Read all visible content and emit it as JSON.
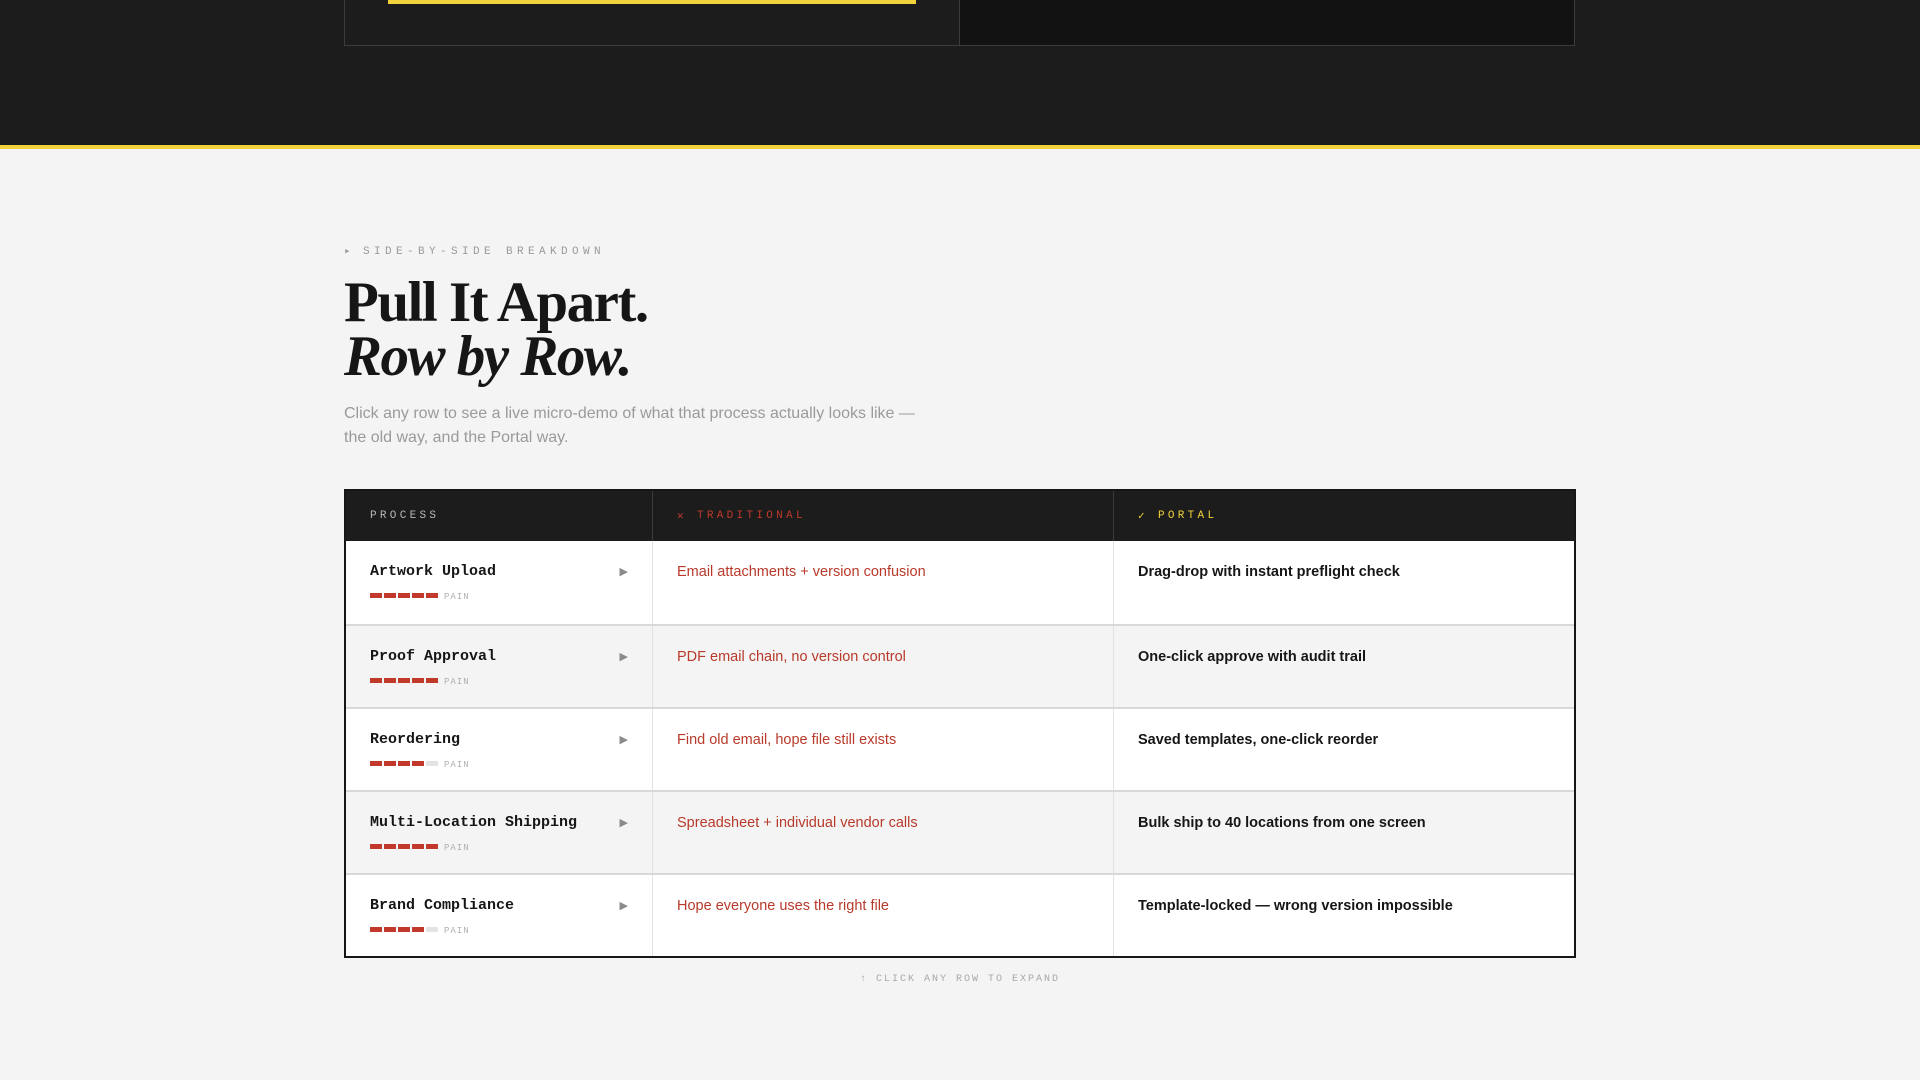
{
  "header_band": {
    "progress_color": "#f2d23a"
  },
  "section": {
    "eyebrow_marker": "▸",
    "eyebrow": "SIDE-BY-SIDE BREAKDOWN",
    "title_line1": "Pull It Apart.",
    "title_line2": "Row by Row.",
    "subtitle": "Click any row to see a live micro-demo of what that process actually looks like — the old way, and the Portal way."
  },
  "table": {
    "headers": {
      "process": "PROCESS",
      "traditional_marker": "✕",
      "traditional": "TRADITIONAL",
      "portal_marker": "✓",
      "portal": "PORTAL"
    },
    "pain_label": "PAIN",
    "expand_icon": "▶",
    "rows": [
      {
        "process": "Artwork Upload",
        "pain": 5,
        "pain_max": 5,
        "traditional": "Email attachments + version confusion",
        "portal": "Drag-drop with instant preflight check"
      },
      {
        "process": "Proof Approval",
        "pain": 5,
        "pain_max": 5,
        "traditional": "PDF email chain, no version control",
        "portal": "One-click approve with audit trail"
      },
      {
        "process": "Reordering",
        "pain": 4,
        "pain_max": 5,
        "traditional": "Find old email, hope file still exists",
        "portal": "Saved templates, one-click reorder"
      },
      {
        "process": "Multi-Location Shipping",
        "pain": 5,
        "pain_max": 5,
        "traditional": "Spreadsheet + individual vendor calls",
        "portal": "Bulk ship to 40 locations from one screen"
      },
      {
        "process": "Brand Compliance",
        "pain": 4,
        "pain_max": 5,
        "traditional": "Hope everyone uses the right file",
        "portal": "Template-locked — wrong version impossible"
      }
    ]
  },
  "hint": "↑ CLICK ANY ROW TO EXPAND",
  "colors": {
    "dark": "#1c1c1c",
    "accent_yellow": "#f2d23a",
    "traditional_red": "#c0392b",
    "page_bg": "#f4f4f4"
  }
}
